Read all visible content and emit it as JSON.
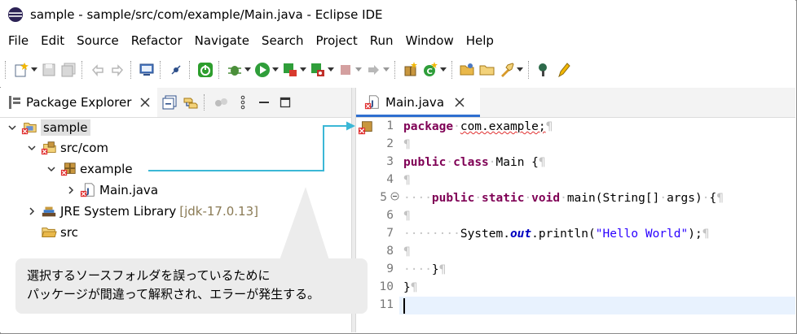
{
  "window": {
    "title": "sample - sample/src/com/example/Main.java - Eclipse IDE"
  },
  "menu": [
    "File",
    "Edit",
    "Source",
    "Refactor",
    "Navigate",
    "Search",
    "Project",
    "Run",
    "Window",
    "Help"
  ],
  "package_explorer": {
    "tab_label": "Package Explorer",
    "tree": [
      {
        "label": "sample",
        "decoration": "",
        "icon": "java-project-error-icon"
      },
      {
        "label": "src/com",
        "decoration": "",
        "icon": "source-folder-error-icon"
      },
      {
        "label": "example",
        "decoration": "",
        "icon": "package-error-icon"
      },
      {
        "label": "Main.java",
        "decoration": "",
        "icon": "java-file-icon"
      },
      {
        "label": "JRE System Library",
        "decoration": "[jdk-17.0.13]",
        "icon": "library-icon"
      },
      {
        "label": "src",
        "decoration": "",
        "icon": "folder-icon"
      }
    ]
  },
  "editor": {
    "tab_label": "Main.java",
    "line_numbers": [
      "1",
      "2",
      "3",
      "4",
      "5",
      "6",
      "7",
      "8",
      "9",
      "10",
      "11"
    ],
    "lines": {
      "l1_kw": "package",
      "l1_rest": "com.example;",
      "l3_kw1": "public",
      "l3_kw2": "class",
      "l3_rest": "Main {",
      "l5_kw1": "public",
      "l5_kw2": "static",
      "l5_kw3": "void",
      "l5_rest1": "main(String[]",
      "l5_rest2": "args)",
      "l5_rest3": "{",
      "l7_pre": "System.",
      "l7_field": "out",
      "l7_mid": ".println(",
      "l7_str": "\"Hello World\"",
      "l7_post": ");",
      "l9_rest": "}",
      "l10_rest": "}"
    }
  },
  "callout": {
    "line1": "選択するソースフォルダを誤っているために",
    "line2": "パッケージが間違って解釈され、エラーが発生する。"
  },
  "colors": {
    "keyword": "#7f0055",
    "string": "#2a00ff",
    "static_field": "#0000c0",
    "arrow": "#3bb7d6",
    "error": "#e03030"
  }
}
